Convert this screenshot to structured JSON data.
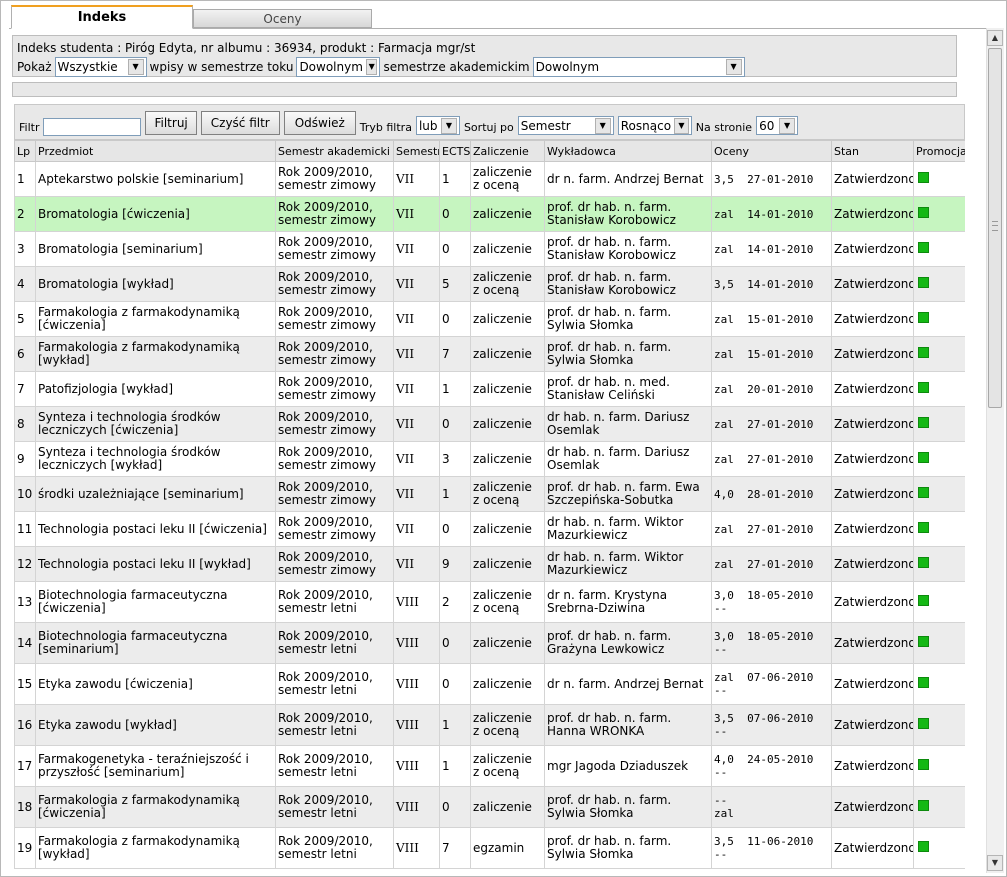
{
  "tabs": [
    {
      "label": "Indeks",
      "active": true
    },
    {
      "label": "Oceny",
      "active": false
    }
  ],
  "info": {
    "student_line": "Indeks studenta : Piróg Edyta, nr albumu : 36934, produkt : Farmacja mgr/st",
    "show_label": "Pokaż",
    "show_value": "Wszystkie",
    "entries_label": "wpisy w semestrze toku",
    "semester_value": "Dowolnym",
    "academic_label": "semestrze akademickim",
    "academic_value": "Dowolnym"
  },
  "filter": {
    "filter_label": "Filtr",
    "filter_value": "",
    "filter_button": "Filtruj",
    "clear_button": "Czyść filtr",
    "refresh_button": "Odśwież",
    "mode_label": "Tryb filtra",
    "mode_value": "lub",
    "sort_label": "Sortuj po",
    "sort_value": "Semestr",
    "order_value": "Rosnąco",
    "per_page_label": "Na stronie",
    "per_page_value": "60"
  },
  "table": {
    "headers": [
      "Lp",
      "Przedmiot",
      "Semestr akademicki",
      "Semestr",
      "ECTS",
      "Zaliczenie",
      "Wykładowca",
      "Oceny",
      "Stan",
      "Promocja"
    ],
    "rows": [
      {
        "lp": "1",
        "subject": "Aptekarstwo polskie [seminarium]",
        "term": "Rok 2009/2010, semestr zimowy",
        "sem": "VII",
        "ects": "1",
        "credit": "zaliczenie z oceną",
        "lecturer": "dr n. farm. Andrzej Bernat",
        "grades": "3,5  27-01-2010",
        "state": "Zatwierdzono"
      },
      {
        "lp": "2",
        "subject": "Bromatologia [ćwiczenia]",
        "term": "Rok 2009/2010, semestr zimowy",
        "sem": "VII",
        "ects": "0",
        "credit": "zaliczenie",
        "lecturer": "prof. dr hab. n. farm. Stanisław Korobowicz",
        "grades": "zal  14-01-2010",
        "state": "Zatwierdzono"
      },
      {
        "lp": "3",
        "subject": "Bromatologia [seminarium]",
        "term": "Rok 2009/2010, semestr zimowy",
        "sem": "VII",
        "ects": "0",
        "credit": "zaliczenie",
        "lecturer": "prof. dr hab. n. farm. Stanisław Korobowicz",
        "grades": "zal  14-01-2010",
        "state": "Zatwierdzono"
      },
      {
        "lp": "4",
        "subject": "Bromatologia [wykład]",
        "term": "Rok 2009/2010, semestr zimowy",
        "sem": "VII",
        "ects": "5",
        "credit": "zaliczenie z oceną",
        "lecturer": "prof. dr hab. n. farm. Stanisław Korobowicz",
        "grades": "3,5  14-01-2010",
        "state": "Zatwierdzono"
      },
      {
        "lp": "5",
        "subject": "Farmakologia z farmakodynamiką [ćwiczenia]",
        "term": "Rok 2009/2010, semestr zimowy",
        "sem": "VII",
        "ects": "0",
        "credit": "zaliczenie",
        "lecturer": "prof. dr hab. n. farm. Sylwia Słomka",
        "grades": "zal  15-01-2010",
        "state": "Zatwierdzono"
      },
      {
        "lp": "6",
        "subject": "Farmakologia z farmakodynamiką [wykład]",
        "term": "Rok 2009/2010, semestr zimowy",
        "sem": "VII",
        "ects": "7",
        "credit": "zaliczenie",
        "lecturer": "prof. dr hab. n. farm. Sylwia Słomka",
        "grades": "zal  15-01-2010",
        "state": "Zatwierdzono"
      },
      {
        "lp": "7",
        "subject": "Patofizjologia [wykład]",
        "term": "Rok 2009/2010, semestr zimowy",
        "sem": "VII",
        "ects": "1",
        "credit": "zaliczenie",
        "lecturer": "prof. dr hab. n. med. Stanisław Celiński",
        "grades": "zal  20-01-2010",
        "state": "Zatwierdzono"
      },
      {
        "lp": "8",
        "subject": "Synteza i technologia środków leczniczych [ćwiczenia]",
        "term": "Rok 2009/2010, semestr zimowy",
        "sem": "VII",
        "ects": "0",
        "credit": "zaliczenie",
        "lecturer": "dr hab. n. farm. Dariusz Osemlak",
        "grades": "zal  27-01-2010",
        "state": "Zatwierdzono"
      },
      {
        "lp": "9",
        "subject": "Synteza i technologia środków leczniczych [wykład]",
        "term": "Rok 2009/2010, semestr zimowy",
        "sem": "VII",
        "ects": "3",
        "credit": "zaliczenie",
        "lecturer": "dr hab. n. farm. Dariusz Osemlak",
        "grades": "zal  27-01-2010",
        "state": "Zatwierdzono"
      },
      {
        "lp": "10",
        "subject": "środki uzależniające [seminarium]",
        "term": "Rok 2009/2010, semestr zimowy",
        "sem": "VII",
        "ects": "1",
        "credit": "zaliczenie z oceną",
        "lecturer": "prof. dr hab. n. farm. Ewa Szczepińska-Sobutka",
        "grades": "4,0  28-01-2010",
        "state": "Zatwierdzono"
      },
      {
        "lp": "11",
        "subject": "Technologia postaci leku II [ćwiczenia]",
        "term": "Rok 2009/2010, semestr zimowy",
        "sem": "VII",
        "ects": "0",
        "credit": "zaliczenie",
        "lecturer": "dr hab. n. farm. Wiktor Mazurkiewicz",
        "grades": "zal  27-01-2010",
        "state": "Zatwierdzono"
      },
      {
        "lp": "12",
        "subject": "Technologia postaci leku II [wykład]",
        "term": "Rok 2009/2010, semestr zimowy",
        "sem": "VII",
        "ects": "9",
        "credit": "zaliczenie",
        "lecturer": "dr hab. n. farm. Wiktor Mazurkiewicz",
        "grades": "zal  27-01-2010",
        "state": "Zatwierdzono"
      },
      {
        "lp": "13",
        "subject": "Biotechnologia farmaceutyczna [ćwiczenia]",
        "term": "Rok 2009/2010, semestr letni",
        "sem": "VIII",
        "ects": "2",
        "credit": "zaliczenie z oceną",
        "lecturer": "dr n. farm. Krystyna Srebrna-Dziwina",
        "grades": "3,0  18-05-2010\n--",
        "state": "Zatwierdzono"
      },
      {
        "lp": "14",
        "subject": "Biotechnologia farmaceutyczna [seminarium]",
        "term": "Rok 2009/2010, semestr letni",
        "sem": "VIII",
        "ects": "0",
        "credit": "zaliczenie",
        "lecturer": "prof. dr hab. n. farm. Grażyna Lewkowicz",
        "grades": "3,0  18-05-2010\n--",
        "state": "Zatwierdzono"
      },
      {
        "lp": "15",
        "subject": "Etyka zawodu [ćwiczenia]",
        "term": "Rok 2009/2010, semestr letni",
        "sem": "VIII",
        "ects": "0",
        "credit": "zaliczenie",
        "lecturer": "dr n. farm. Andrzej Bernat",
        "grades": "zal  07-06-2010\n--",
        "state": "Zatwierdzono"
      },
      {
        "lp": "16",
        "subject": "Etyka zawodu [wykład]",
        "term": "Rok 2009/2010, semestr letni",
        "sem": "VIII",
        "ects": "1",
        "credit": "zaliczenie z oceną",
        "lecturer": "prof. dr hab. n. farm. Hanna WRONKA",
        "grades": "3,5  07-06-2010\n--",
        "state": "Zatwierdzono"
      },
      {
        "lp": "17",
        "subject": "Farmakogenetyka - teraźniejszość i przyszłość [seminarium]",
        "term": "Rok 2009/2010, semestr letni",
        "sem": "VIII",
        "ects": "1",
        "credit": "zaliczenie z oceną",
        "lecturer": "mgr Jagoda Dziaduszek",
        "grades": "4,0  24-05-2010\n--",
        "state": "Zatwierdzono"
      },
      {
        "lp": "18",
        "subject": "Farmakologia z farmakodynamiką [ćwiczenia]",
        "term": "Rok 2009/2010, semestr letni",
        "sem": "VIII",
        "ects": "0",
        "credit": "zaliczenie",
        "lecturer": "prof. dr hab. n. farm. Sylwia Słomka",
        "grades": "--\nzal",
        "state": "Zatwierdzono"
      },
      {
        "lp": "19",
        "subject": "Farmakologia z farmakodynamiką [wykład]",
        "term": "Rok 2009/2010, semestr letni",
        "sem": "VIII",
        "ects": "7",
        "credit": "egzamin",
        "lecturer": "prof. dr hab. n. farm. Sylwia Słomka",
        "grades": "3,5  11-06-2010\n--",
        "state": "Zatwierdzono"
      }
    ]
  },
  "colors": {
    "highlight_row": "#c6f5c0",
    "promo_square": "#14b814",
    "tab_accent": "#f0a020"
  }
}
